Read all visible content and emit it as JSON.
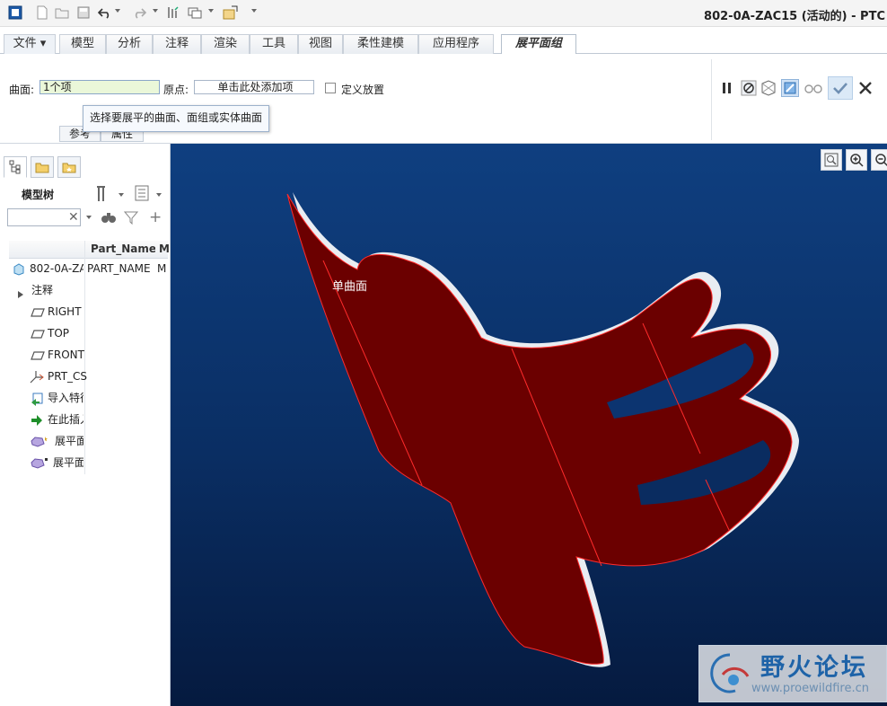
{
  "window": {
    "title": "802-0A-ZAC15 (活动的) - PTC"
  },
  "ribbon_tabs": [
    {
      "label": "文件 ▾"
    },
    {
      "label": "模型"
    },
    {
      "label": "分析"
    },
    {
      "label": "注释"
    },
    {
      "label": "渲染"
    },
    {
      "label": "工具"
    },
    {
      "label": "视图"
    },
    {
      "label": "柔性建模"
    },
    {
      "label": "应用程序"
    },
    {
      "label": "展平面组"
    }
  ],
  "ribbon": {
    "surface_label": "曲面:",
    "surface_value": "1个项",
    "origin_label": "原点:",
    "origin_value": "单击此处添加项",
    "define_placement_label": "定义放置",
    "tooltip": "选择要展平的曲面、面组或实体曲面",
    "subtabs": [
      {
        "label": "参考"
      },
      {
        "label": "属性"
      }
    ]
  },
  "model_tree": {
    "title": "模型树",
    "search_value": "",
    "columns": [
      "Part_Name",
      "M"
    ],
    "root": {
      "name": "802-0A-ZA",
      "part_name": "PART_NAME",
      "m": "M"
    },
    "items": [
      {
        "label": "注释",
        "icon": "expand-arrow-icon"
      },
      {
        "label": "RIGHT",
        "icon": "datum-plane-icon"
      },
      {
        "label": "TOP",
        "icon": "datum-plane-icon"
      },
      {
        "label": "FRONT",
        "icon": "datum-plane-icon"
      },
      {
        "label": "PRT_CS",
        "icon": "coordinate-system-icon"
      },
      {
        "label": "导入特征",
        "icon": "import-feature-icon"
      },
      {
        "label": "在此插入",
        "icon": "insert-here-icon"
      },
      {
        "label": "展平面",
        "icon": "flatten-quilt-icon"
      },
      {
        "label": "展平面",
        "icon": "flatten-quilt-icon"
      }
    ]
  },
  "viewport": {
    "label": "单曲面",
    "surface_color": "#6b0000"
  },
  "watermark": {
    "title": "野火论坛",
    "url": "www.proewildfire.cn"
  }
}
